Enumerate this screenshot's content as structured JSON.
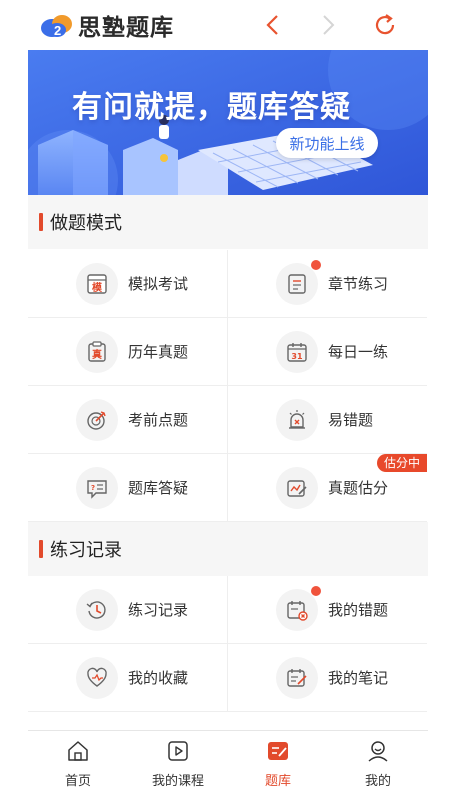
{
  "header": {
    "app_name": "思塾题库"
  },
  "banner": {
    "title": "有问就提，题库答疑",
    "pill": "新功能上线"
  },
  "practice_mode": {
    "title": "做题模式",
    "items": [
      {
        "label": "模拟考试",
        "icon": "mock-exam-icon",
        "icon_text": "模"
      },
      {
        "label": "章节练习",
        "icon": "chapter-list-icon",
        "has_dot": true
      },
      {
        "label": "历年真题",
        "icon": "past-papers-icon",
        "icon_text": "真"
      },
      {
        "label": "每日一练",
        "icon": "calendar-icon",
        "icon_text": "31"
      },
      {
        "label": "考前点题",
        "icon": "target-icon"
      },
      {
        "label": "易错题",
        "icon": "alarm-icon"
      },
      {
        "label": "题库答疑",
        "icon": "qa-chat-icon"
      },
      {
        "label": "真题估分",
        "icon": "score-estimate-icon",
        "tag": "估分中"
      }
    ]
  },
  "records": {
    "title": "练习记录",
    "items": [
      {
        "label": "练习记录",
        "icon": "history-icon"
      },
      {
        "label": "我的错题",
        "icon": "wrong-questions-icon",
        "has_dot": true
      },
      {
        "label": "我的收藏",
        "icon": "heart-icon"
      },
      {
        "label": "我的笔记",
        "icon": "notes-icon"
      }
    ]
  },
  "tabbar": {
    "tabs": [
      {
        "label": "首页",
        "icon": "home-icon"
      },
      {
        "label": "我的课程",
        "icon": "play-icon"
      },
      {
        "label": "题库",
        "icon": "question-bank-icon",
        "active": true
      },
      {
        "label": "我的",
        "icon": "profile-icon"
      }
    ]
  },
  "colors": {
    "accent": "#e24a2c",
    "banner_blue": "#3e63e6",
    "dot": "#f0533c"
  }
}
